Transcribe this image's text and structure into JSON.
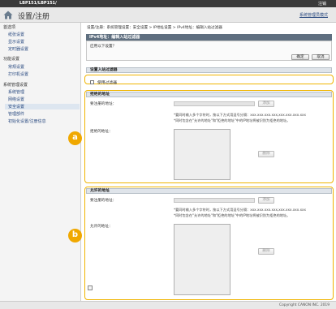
{
  "topbar": {
    "model": "LBP151/LBP151/",
    "logout": "注销"
  },
  "header": {
    "title": "设置/注册",
    "admin_link": "系统管理员模式"
  },
  "sidebar": {
    "groups": [
      {
        "heading": "首选项",
        "items": [
          "纸张设置",
          "显示设置",
          "定时器设置"
        ]
      },
      {
        "heading": "功能设置",
        "items": [
          "常规设置",
          "打印机设置"
        ]
      },
      {
        "heading": "系统管理设置",
        "items": [
          "系统管理",
          "网络设置",
          "安全设置",
          "管理部件",
          "初始化设置",
          "初始化设置/注册信息"
        ]
      }
    ],
    "heading_first": "首选项",
    "item_paper": "纸张设置",
    "item_display": "显示设置",
    "item_timer": "定时器设置",
    "heading_func": "功能设置",
    "item_general": "常规设置",
    "item_printer": "打印机设置",
    "heading_system": "系统管理设置",
    "item_sysmgmt": "系统管理",
    "item_network": "网络设置",
    "item_security": "安全设置",
    "item_mgmt": "管理部件",
    "item_init": "初始化设置/注册信息"
  },
  "breadcrumb": "设置/注册：系统管理设置：安全设置 > IP地址设置 > IPv4地址：编辑入站过滤器",
  "page_title": "IPv4地址：编辑入站过滤器",
  "apply": {
    "message": "应用以下设置？",
    "ok": "确定",
    "cancel": "取消"
  },
  "filter_section": {
    "head": "设置入站过滤器",
    "checkbox_label": "使用过滤器"
  },
  "reject": {
    "head": "拒绝的地址",
    "address_label": "要注册的地址：",
    "add_button": "添加",
    "note1": "*要同时输入多个字符时，按以下方式用逗号分隔：xxx.xxx.xxx.xxx,xxx.xxx.xxx.xxx",
    "note2": "*同时包含在\"允许的地址\"和\"拒绝的地址\"中的IP地址将被识别为拒绝的地址。",
    "list_label": "拒绝的地址：",
    "delete_button": "删除"
  },
  "allow": {
    "head": "允许的地址",
    "address_label": "要注册的地址：",
    "add_button": "添加",
    "note1": "*要同时输入多个字符时，按以下方式用逗号分隔：xxx.xxx.xxx.xxx,xxx.xxx.xxx.xxx",
    "note2": "*同时包含在\"允许的地址\"和\"拒绝的地址\"中的IP地址将被识别为拒绝的地址。",
    "list_label": "允许的地址：",
    "delete_button": "删除"
  },
  "badges": {
    "a": "a",
    "b": "b"
  },
  "footer": {
    "copyright": "Copyright CANON INC. 2019"
  },
  "colors": {
    "highlight": "#f0b400",
    "title_bar": "#5f6f80",
    "top_bar": "#3a3a3a"
  },
  "icons": {
    "home": "home-icon",
    "to_top": "to-top-icon"
  }
}
